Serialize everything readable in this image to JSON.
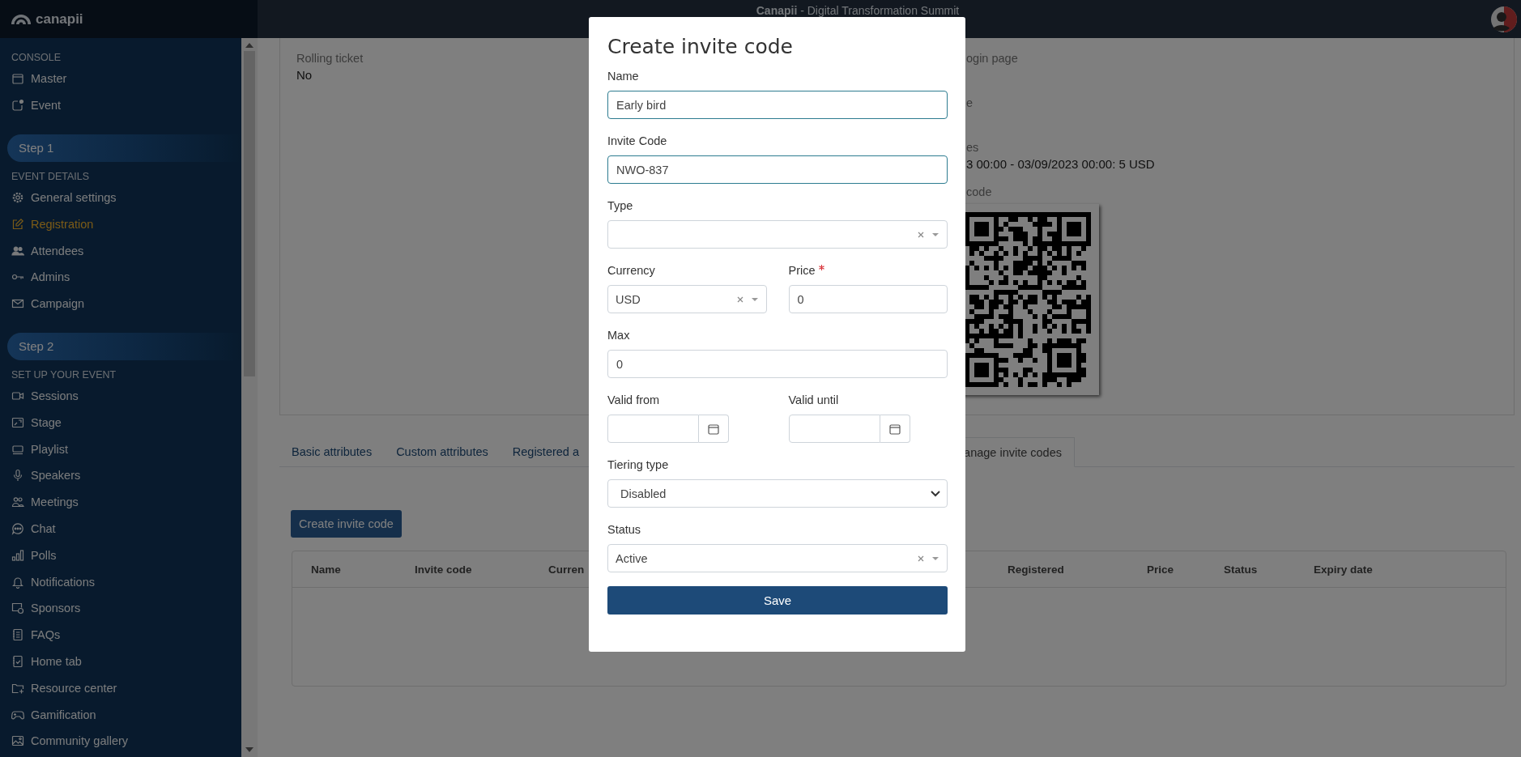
{
  "topbar": {
    "logo": "canapii",
    "title": "**Canapii** - Digital Transformation Summit"
  },
  "sidebar": {
    "sections": [
      {
        "heading": "CONSOLE",
        "items": [
          {
            "label": "Master",
            "selected": false
          },
          {
            "label": "Event",
            "selected": false
          }
        ]
      },
      {
        "step": "Step 1",
        "heading": "EVENT DETAILS",
        "items": [
          {
            "label": "General settings",
            "selected": false
          },
          {
            "label": "Registration",
            "selected": true
          },
          {
            "label": "Attendees",
            "selected": false
          },
          {
            "label": "Admins",
            "selected": false
          },
          {
            "label": "Campaign",
            "selected": false
          }
        ]
      },
      {
        "step": "Step 2",
        "heading": "SET UP YOUR EVENT",
        "items": [
          {
            "label": "Sessions",
            "selected": false
          },
          {
            "label": "Stage",
            "selected": false
          },
          {
            "label": "Playlist",
            "selected": false
          },
          {
            "label": "Speakers",
            "selected": false
          },
          {
            "label": "Meetings",
            "selected": false
          },
          {
            "label": "Chat",
            "selected": false
          },
          {
            "label": "Polls",
            "selected": false
          },
          {
            "label": "Notifications",
            "selected": false
          },
          {
            "label": "Sponsors",
            "selected": false
          },
          {
            "label": "FAQs",
            "selected": false
          },
          {
            "label": "Home tab",
            "selected": false
          },
          {
            "label": "Resource center",
            "selected": false
          },
          {
            "label": "Gamification",
            "selected": false
          },
          {
            "label": "Community gallery",
            "selected": false
          }
        ]
      }
    ]
  },
  "details": {
    "left": [
      {
        "label": "Rolling ticket",
        "value": "No"
      }
    ],
    "right": [
      {
        "label": "ogin page"
      },
      {
        "label": "e"
      },
      {
        "label": "es",
        "value": "3 00:00 - 03/09/2023 00:00: 5 USD"
      },
      {
        "label": "code",
        "kind": "qr"
      }
    ]
  },
  "tabs": [
    {
      "label": "Basic attributes",
      "selected": false
    },
    {
      "label": "Custom attributes",
      "selected": false
    },
    {
      "label": "Registered a",
      "selected": false
    },
    {
      "label": "anage invite codes",
      "selected": true
    }
  ],
  "create_button": "Create invite code",
  "table": {
    "columns": [
      "Name",
      "Invite code",
      "Curren",
      "Registered",
      "Price",
      "Status",
      "Expiry date"
    ]
  },
  "modal": {
    "title": "Create invite code",
    "rows": [
      {
        "fields": [
          {
            "kind": "text",
            "label": "Name",
            "value": "Early bird",
            "highlighted": true
          }
        ]
      },
      {
        "fields": [
          {
            "kind": "text",
            "label": "Invite Code",
            "value": "NWO-837",
            "highlighted": true
          }
        ]
      },
      {
        "fields": [
          {
            "kind": "select",
            "label": "Type",
            "clearable": true
          }
        ]
      },
      {
        "fields": [
          {
            "kind": "select",
            "label": "Currency",
            "value": "USD",
            "clearable": true
          },
          {
            "kind": "text",
            "label": "Price",
            "value": "0",
            "required": true,
            "highlighted": false
          }
        ]
      },
      {
        "fields": [
          {
            "kind": "text",
            "label": "Max",
            "value": "0",
            "highlighted": false
          }
        ]
      },
      {
        "fields": [
          {
            "kind": "date",
            "label": "Valid from"
          },
          {
            "kind": "date",
            "label": "Valid until"
          }
        ]
      },
      {
        "fields": [
          {
            "kind": "native-select",
            "label": "Tiering type",
            "value": "Disabled"
          }
        ]
      },
      {
        "fields": [
          {
            "kind": "select",
            "label": "Status",
            "value": "Active",
            "clearable": true
          }
        ]
      }
    ],
    "save": "Save"
  }
}
